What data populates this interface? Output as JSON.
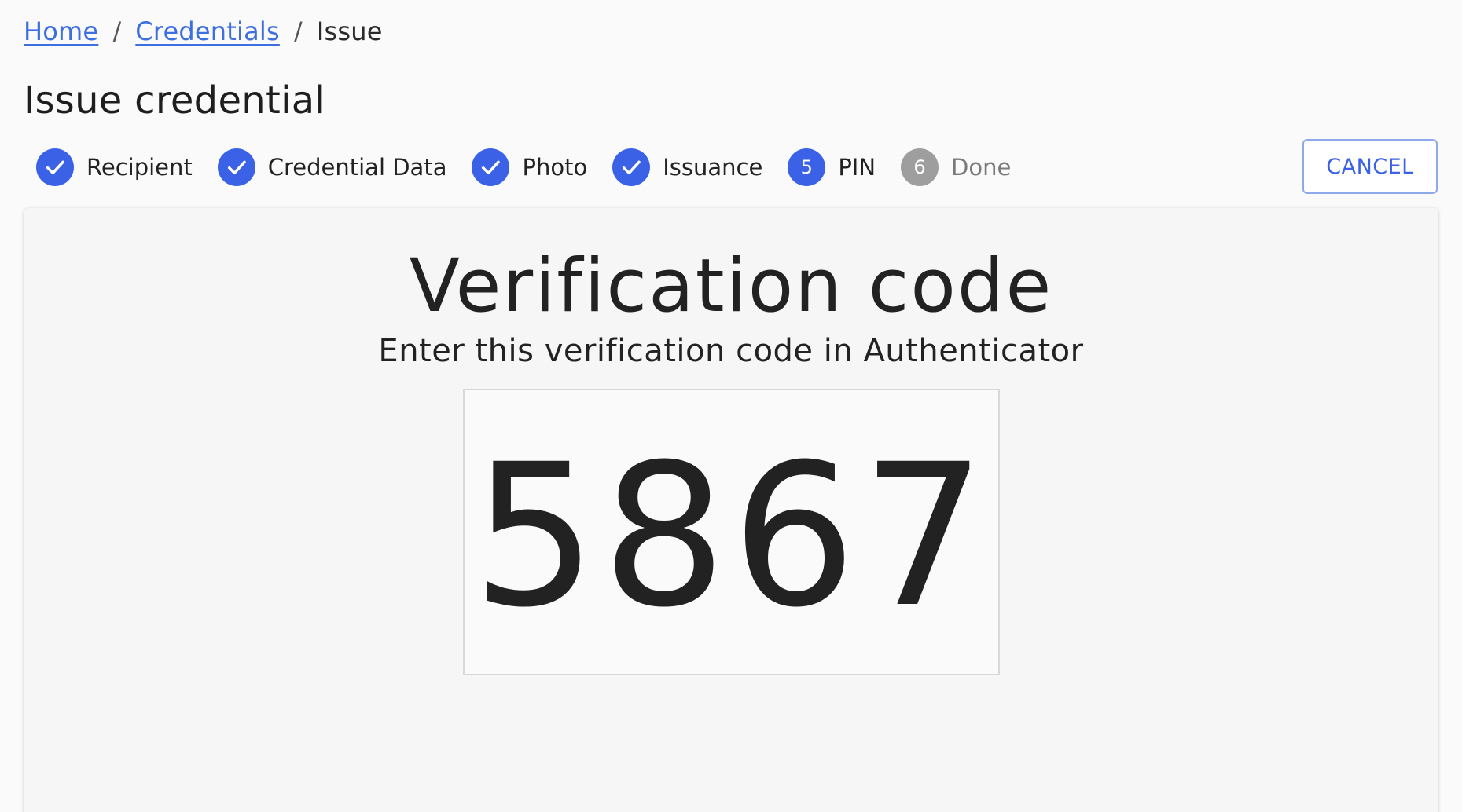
{
  "breadcrumb": {
    "items": [
      {
        "label": "Home",
        "link": true
      },
      {
        "label": "Credentials",
        "link": true
      },
      {
        "label": "Issue",
        "link": false
      }
    ],
    "separator": "/"
  },
  "page": {
    "title": "Issue credential"
  },
  "stepper": {
    "steps": [
      {
        "label": "Recipient",
        "state": "completed",
        "icon": "check-icon"
      },
      {
        "label": "Credential Data",
        "state": "completed",
        "icon": "check-icon"
      },
      {
        "label": "Photo",
        "state": "completed",
        "icon": "check-icon"
      },
      {
        "label": "Issuance",
        "state": "completed",
        "icon": "check-icon"
      },
      {
        "label": "PIN",
        "state": "active",
        "number": "5"
      },
      {
        "label": "Done",
        "state": "pending",
        "number": "6"
      }
    ]
  },
  "actions": {
    "cancel_label": "CANCEL"
  },
  "verification": {
    "title": "Verification code",
    "subtitle": "Enter this verification code in Authenticator",
    "code": "5867"
  },
  "colors": {
    "accent": "#3b62e6",
    "link": "#3d6fe0",
    "pending_step": "#9e9e9e",
    "page_background": "#fafafa",
    "card_background": "#f6f6f6"
  }
}
